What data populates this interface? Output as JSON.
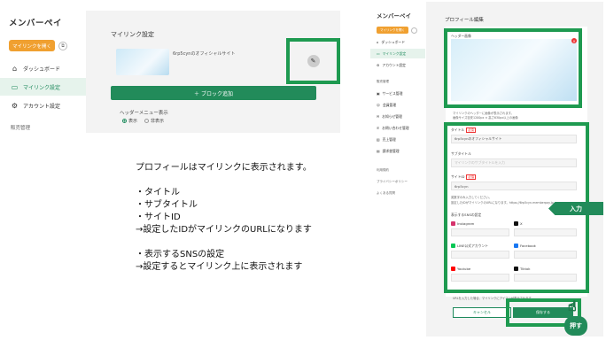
{
  "left_app": {
    "brand": "メンバーペイ",
    "create_button": "マイリンクを開く",
    "nav": [
      {
        "label": "ダッシュボード",
        "icon": "home-icon"
      },
      {
        "label": "マイリンク設定",
        "icon": "card-icon",
        "active": true
      },
      {
        "label": "アカウント設定",
        "icon": "gear-icon"
      }
    ],
    "section_label": "販売管理",
    "main_title": "マイリンク設定",
    "site_name": "6rp5cynのオフィシャルサイト",
    "add_block": "＋ ブロック追加",
    "header_menu_label": "ヘッダーメニュー表示",
    "radio_show": "表示",
    "radio_hide": "非表示"
  },
  "explanation": "プロフィールはマイリンクに表示されます。\n\n・タイトル\n・サブタイトル\n・サイトID\n→設定したIDがマイリンクのURLになります\n\n・表示するSNSの設定\n→設定するとマイリンク上に表示されます",
  "right_app": {
    "brand": "メンバーペイ",
    "create_button": "マイリンクを開く",
    "nav": [
      {
        "label": "ダッシュボード"
      },
      {
        "label": "マイリンク設定",
        "active": true
      },
      {
        "label": "アカウント設定"
      }
    ],
    "sec1": "販売管理",
    "nav2": [
      "サービス管理",
      "会員管理",
      "お知らせ管理",
      "お問い合わせ管理",
      "売上管理",
      "請求書管理"
    ],
    "sec2": "利用規約",
    "sec3": "プライバシーポリシー",
    "sec4": "よくある質問",
    "title": "プロフィール編集",
    "header_image_label": "ヘッダー画像",
    "header_note": "マイリンクのヘッダーに画像が表示されます。",
    "header_note2": "画像サイズ目安1200px × 高さ630px以上の画像",
    "title_label": "タイトル",
    "required": "必須",
    "title_value": "6rp5cynのオフィシャルサイト",
    "subtitle_label": "サブタイトル",
    "subtitle_placeholder": "マイリンクのサブタイトルを入力",
    "siteid_label": "サイトID",
    "siteid_value": "6rp5cyn",
    "siteid_note": "英数字のみ入力してください。",
    "siteid_note2": "設定したIDがマイリンクのURLになります。https://6rp5cyn.memberpay.jp",
    "sns_label": "表示するSNSの設定",
    "sns": [
      {
        "name": "Instagram",
        "color": "#d6336c"
      },
      {
        "name": "X",
        "color": "#111111"
      },
      {
        "name": "LINE公式アカウント",
        "color": "#06c755"
      },
      {
        "name": "Facebook",
        "color": "#1877f2"
      },
      {
        "name": "Youtube",
        "color": "#ff0000"
      },
      {
        "name": "Tiktok",
        "color": "#111111"
      }
    ],
    "sns_note": "URLを入力した場合、マイリンクにアイコンが表示されます。",
    "cancel": "キャンセル",
    "save": "保存する"
  },
  "callout_input": "入力",
  "callout_push": "押す",
  "accent": "#1e9a50"
}
